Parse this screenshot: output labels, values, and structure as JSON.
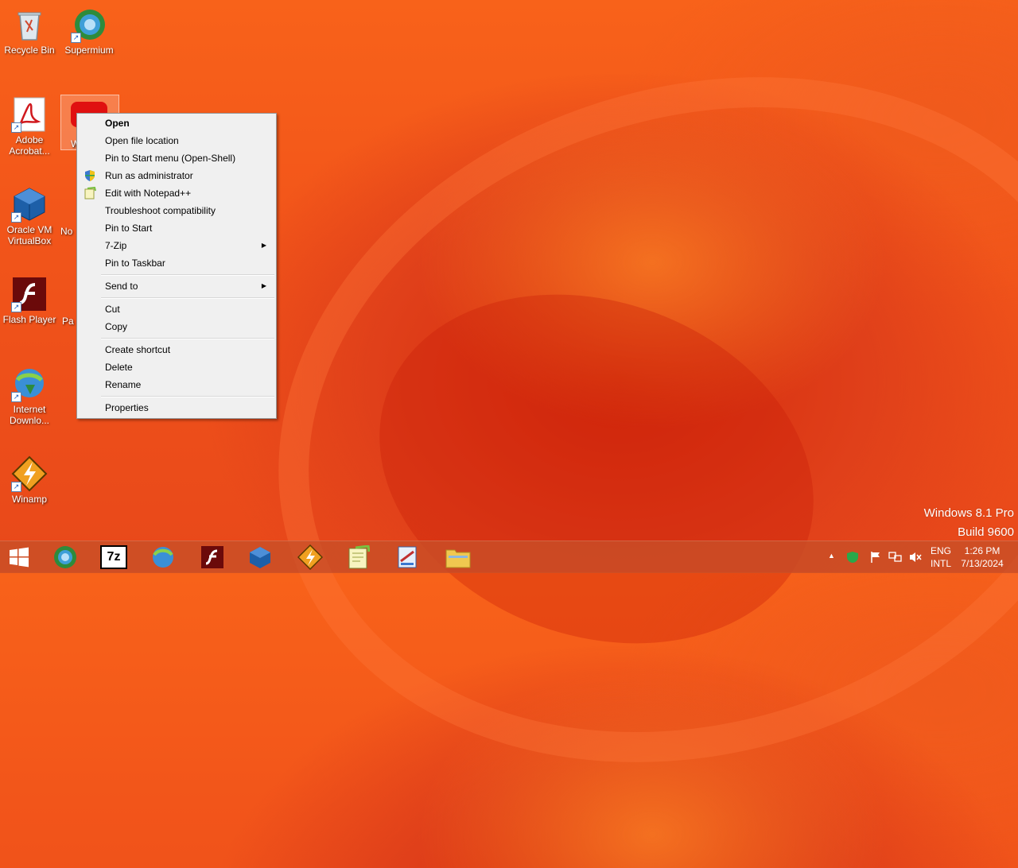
{
  "desktop": {
    "icons": {
      "recycle_bin": "Recycle Bin",
      "supermium": "Supermium",
      "acrobat": "Adobe Acrobat...",
      "selected_partial": "W",
      "virtualbox": "Oracle VM VirtualBox",
      "notepad_partial": "No",
      "flash": "Flash Player",
      "paint_partial": "Pa",
      "idm": "Internet Downlo...",
      "winamp": "Winamp"
    },
    "watermark": {
      "line1": "Windows 8.1 Pro",
      "line2": "Build 9600"
    }
  },
  "context_menu": {
    "items": [
      "Open",
      "Open file location",
      "Pin to Start menu (Open-Shell)",
      "Run as administrator",
      "Edit with Notepad++",
      "Troubleshoot compatibility",
      "Pin to Start",
      "7-Zip",
      "Pin to Taskbar",
      "Send to",
      "Cut",
      "Copy",
      "Create shortcut",
      "Delete",
      "Rename",
      "Properties"
    ]
  },
  "taskbar": {
    "sevenzip_label": "7z",
    "tray": {
      "lang_top": "ENG",
      "lang_bottom": "INTL",
      "time": "1:26 PM",
      "date": "7/13/2024"
    }
  },
  "colors": {
    "accent": "#f2551a",
    "menu_bg": "#f0f0f0"
  }
}
